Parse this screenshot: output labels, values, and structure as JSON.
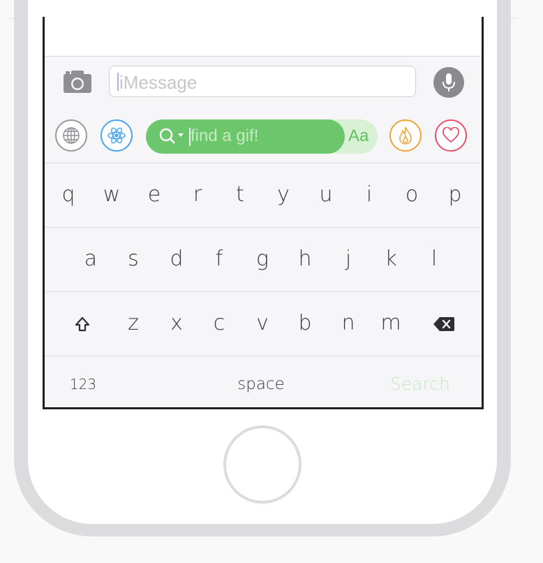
{
  "input_bar": {
    "placeholder": "iMessage",
    "icons": {
      "camera": "camera-icon",
      "microphone": "microphone-icon"
    }
  },
  "gif_bar": {
    "search_placeholder": "find a gif!",
    "text_toggle": "Aa",
    "icons": [
      "globe-icon",
      "atom-icon",
      "search-icon",
      "fire-icon",
      "heart-icon"
    ],
    "colors": {
      "green": "#6cc66c",
      "blue": "#4aa6f0",
      "orange": "#f0a53a",
      "red": "#ee4f6b"
    }
  },
  "keyboard": {
    "row1": [
      "q",
      "w",
      "e",
      "r",
      "t",
      "y",
      "u",
      "i",
      "o",
      "p"
    ],
    "row2": [
      "a",
      "s",
      "d",
      "f",
      "g",
      "h",
      "j",
      "k",
      "l"
    ],
    "row3": [
      "z",
      "x",
      "c",
      "v",
      "b",
      "n",
      "m"
    ],
    "numbers_label": "123",
    "space_label": "space",
    "search_label": "Search"
  }
}
